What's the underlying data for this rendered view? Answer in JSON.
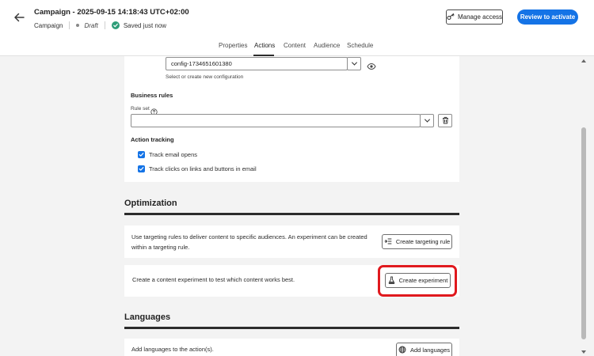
{
  "header": {
    "title": "Campaign - 2025-09-15 14:18:43 UTC+02:00",
    "type": "Campaign",
    "status": "Draft",
    "save_status": "Saved just now",
    "manage_access_label": "Manage access",
    "review_label": "Review to activate",
    "accent_color": "#1473e6"
  },
  "tabs": [
    {
      "label": "Properties"
    },
    {
      "label": "Actions"
    },
    {
      "label": "Content"
    },
    {
      "label": "Audience"
    },
    {
      "label": "Schedule"
    }
  ],
  "active_tab": "Actions",
  "configuration": {
    "value": "config-1734651601380",
    "help": "Select or create new configuration"
  },
  "business_rules": {
    "heading": "Business rules",
    "rule_set_label": "Rule set",
    "rule_set_value": ""
  },
  "action_tracking": {
    "heading": "Action tracking",
    "items": [
      {
        "label": "Track email opens",
        "checked": true
      },
      {
        "label": "Track clicks on links and buttons in email",
        "checked": true
      }
    ]
  },
  "optimization": {
    "title": "Optimization",
    "targeting_text": "Use targeting rules to deliver content to specific audiences. An experiment can be created within a targeting rule.",
    "targeting_button": "Create targeting rule",
    "experiment_text": "Create a content experiment to test which content works best.",
    "experiment_button": "Create experiment"
  },
  "languages": {
    "title": "Languages",
    "text": "Add languages to the action(s).",
    "button": "Add languages"
  }
}
